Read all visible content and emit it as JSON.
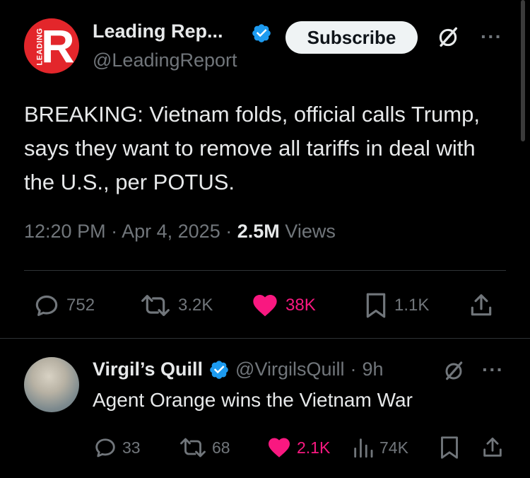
{
  "tweet": {
    "author_name": "Leading Rep...",
    "author_handle": "@LeadingReport",
    "avatar_letter": "R",
    "avatar_vertical_text": "LEADING",
    "subscribe_label": "Subscribe",
    "more_label": "···",
    "text": "BREAKING: Vietnam folds, official calls Trump, says they want to remove all tariffs in deal with the U.S., per POTUS.",
    "time": "12:20 PM",
    "sep": "·",
    "date": "Apr 4, 2025",
    "views_count": "2.5M",
    "views_label": "Views",
    "actions": {
      "replies": "752",
      "reposts": "3.2K",
      "likes": "38K",
      "bookmarks": "1.1K"
    }
  },
  "reply": {
    "author_name": "Virgil’s Quill",
    "author_handle": "@VirgilsQuill",
    "sep": "·",
    "age": "9h",
    "more_label": "···",
    "text": "Agent Orange wins the Vietnam War",
    "actions": {
      "replies": "33",
      "reposts": "68",
      "likes": "2.1K",
      "views": "74K"
    }
  },
  "colors": {
    "background": "#000000",
    "text": "#e7e9ea",
    "muted": "#71767b",
    "verified": "#1d9bf0",
    "like": "#f91880",
    "avatar_brand": "#e3262b"
  },
  "icons": [
    "verified-badge-icon",
    "grok-icon",
    "reply-icon",
    "repost-icon",
    "heart-icon",
    "bookmark-icon",
    "share-icon",
    "views-icon"
  ]
}
